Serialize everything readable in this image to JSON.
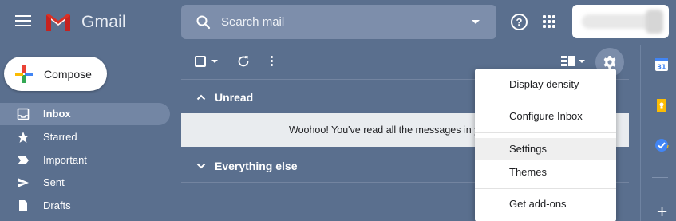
{
  "header": {
    "brand": "Gmail",
    "search_placeholder": "Search mail"
  },
  "compose": {
    "label": "Compose"
  },
  "sidebar": {
    "items": [
      {
        "label": "Inbox",
        "icon": "inbox-icon",
        "active": true
      },
      {
        "label": "Starred",
        "icon": "star-icon"
      },
      {
        "label": "Important",
        "icon": "important-icon"
      },
      {
        "label": "Sent",
        "icon": "send-icon"
      },
      {
        "label": "Drafts",
        "icon": "draft-icon"
      }
    ]
  },
  "main": {
    "sections": [
      {
        "title": "Unread",
        "empty_message": "Woohoo! You've read all the messages in y"
      },
      {
        "title": "Everything else"
      }
    ]
  },
  "settings_menu": {
    "items": [
      {
        "label": "Display density"
      },
      {
        "label": "Configure Inbox"
      },
      {
        "label": "Settings",
        "highlighted": true
      },
      {
        "label": "Themes"
      },
      {
        "label": "Get add-ons"
      }
    ]
  },
  "colors": {
    "background": "#5a6f8e",
    "search_bg": "#7d8eab",
    "active_nav": "#7386a4",
    "gmail_red": "#d93025"
  }
}
